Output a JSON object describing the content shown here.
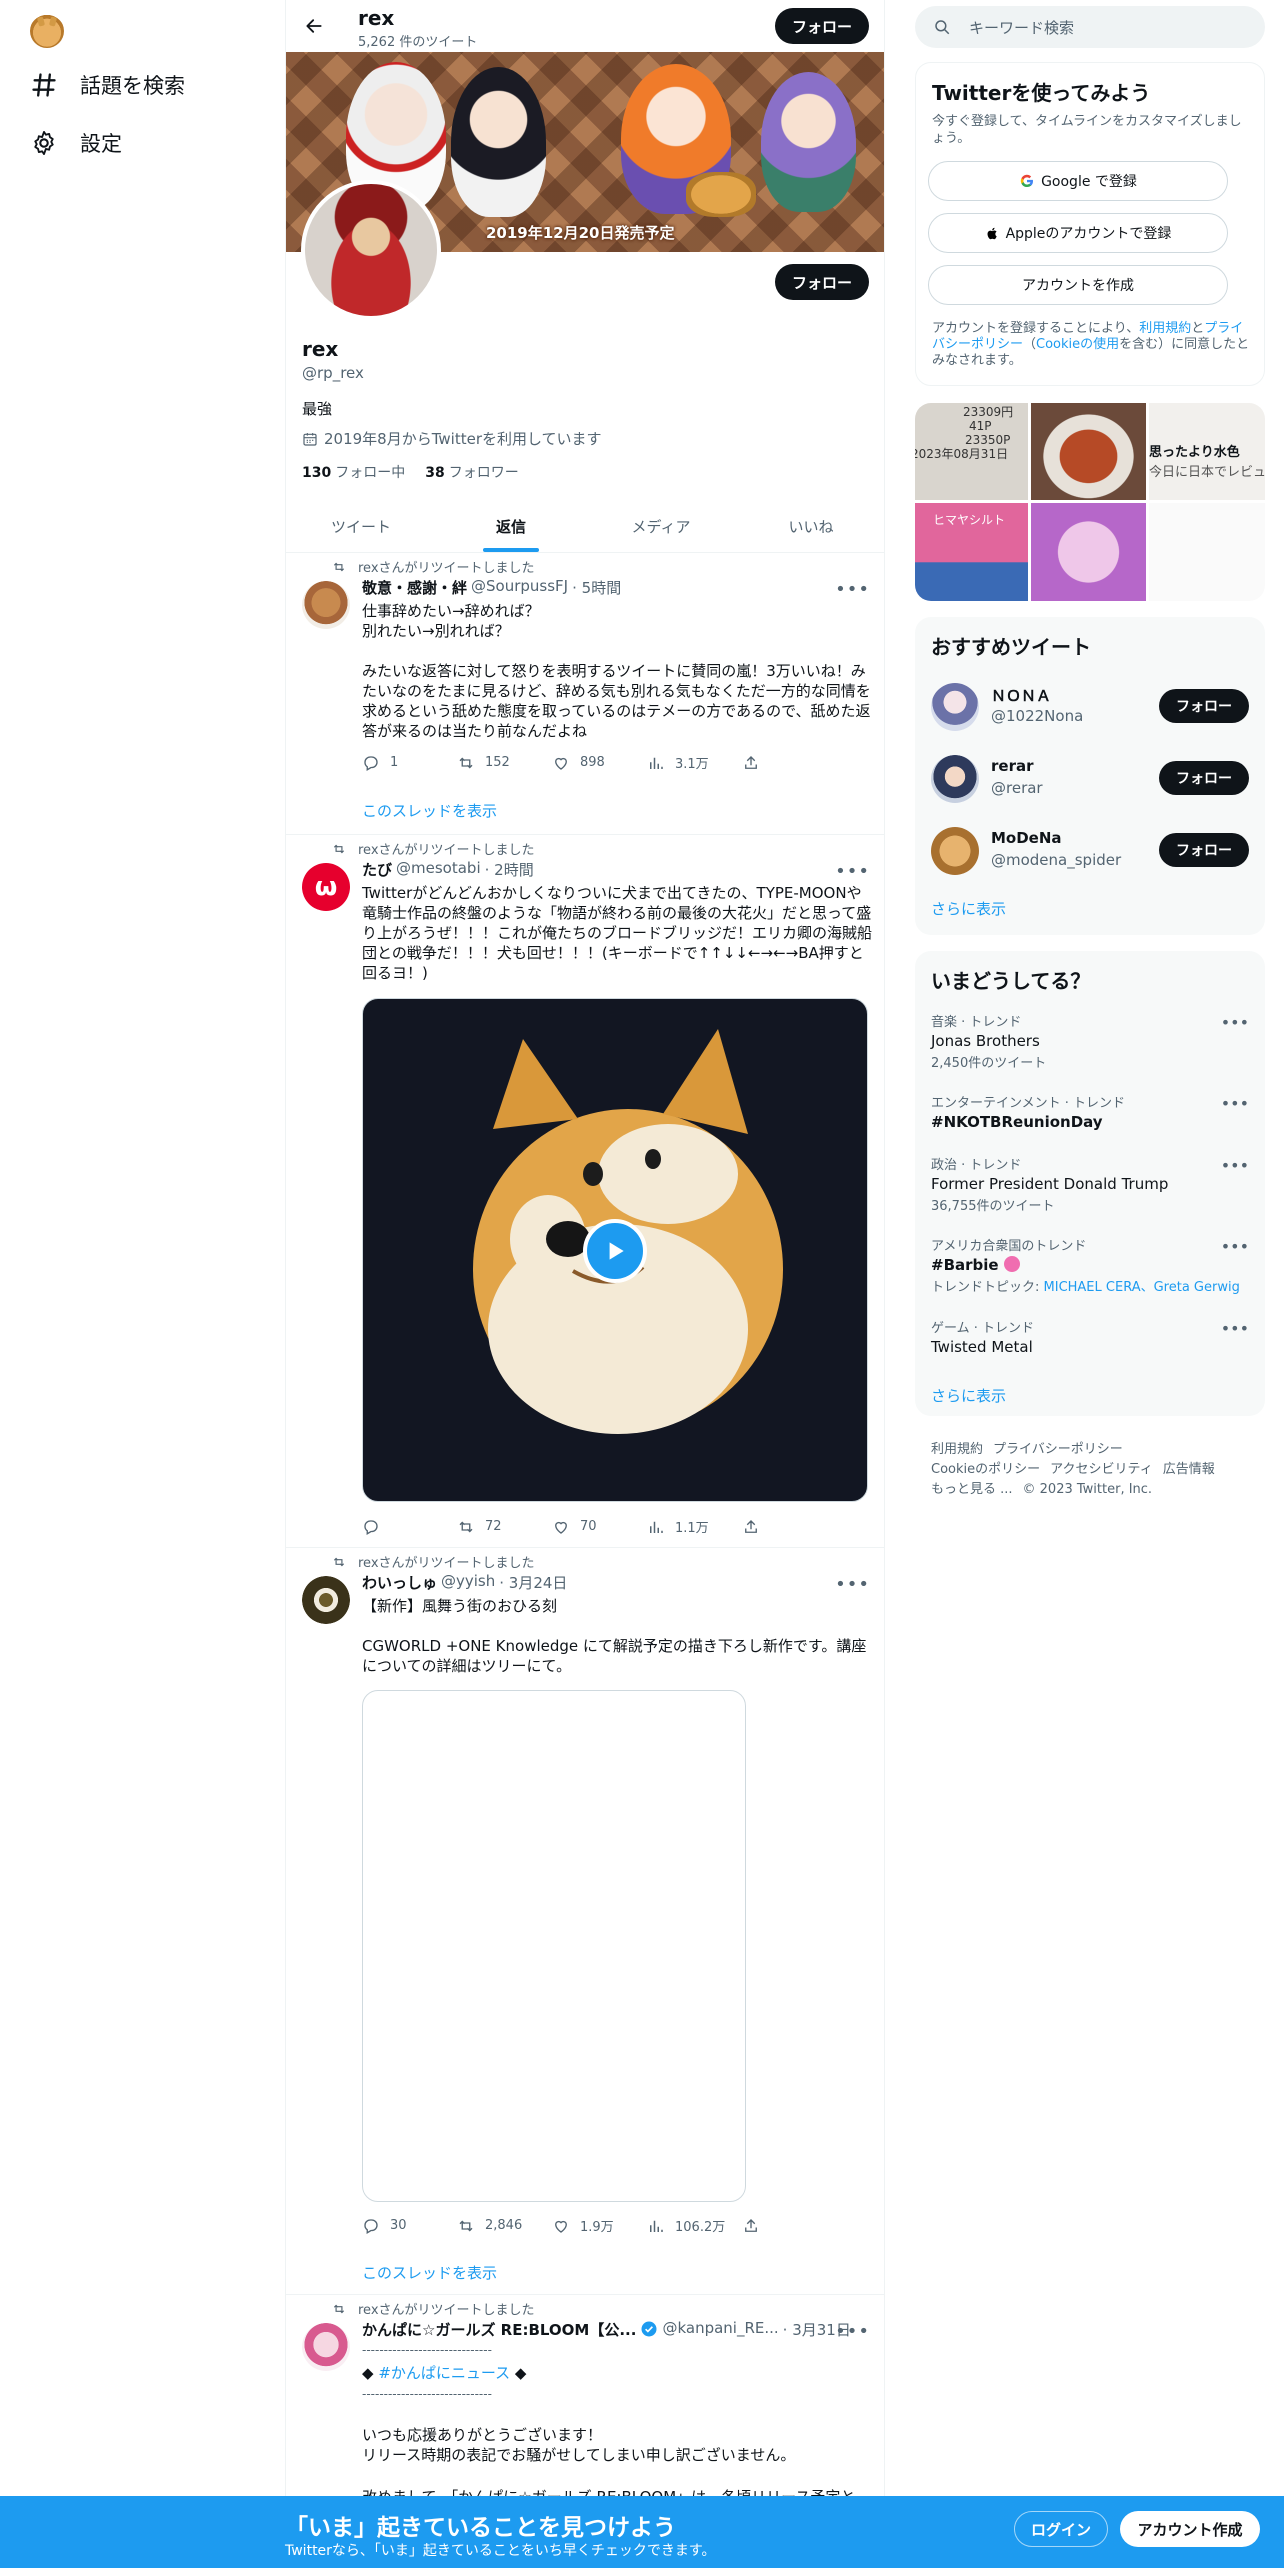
{
  "nav": {
    "explore_label": "話題を検索",
    "settings_label": "設定"
  },
  "profile_header": {
    "name": "rex",
    "tweet_count": "5,262 件のツイート",
    "follow_label": "フォロー"
  },
  "banner": {
    "release_text": "2019年12月20日発売予定"
  },
  "profile": {
    "name": "rex",
    "handle": "@rp_rex",
    "bio": "最強",
    "joined": "2019年8月からTwitterを利用しています",
    "following_count": "130",
    "following_label": "フォロー中",
    "followers_count": "38",
    "followers_label": "フォロワー",
    "follow_label": "フォロー"
  },
  "tabs": [
    "ツイート",
    "返信",
    "メディア",
    "いいね"
  ],
  "tweets": [
    {
      "retweet_label": "rexさんがリツイートしました",
      "name": "敬意・感謝・絆",
      "handle": "@SourpussFJ",
      "time": "· 5時間",
      "text": "仕事辞めたい→辞めれば？\n別れたい→別れれば？\n\nみたいな返答に対して怒りを表明するツイートに賛同の嵐！3万いいね！みたいなのをたまに見るけど、辞める気も別れる気もなくただ一方的な同情を求めるという舐めた態度を取っているのはテメーの方であるので、舐めた返答が来るのは当たり前なんだよね",
      "replies": "1",
      "retweets": "152",
      "likes": "898",
      "views": "3.1万",
      "thread_label": "このスレッドを表示"
    },
    {
      "retweet_label": "rexさんがリツイートしました",
      "name": "たび",
      "handle": "@mesotabi",
      "time": "· 2時間",
      "text": "Twitterがどんどんおかしくなりついに犬まで出てきたの、TYPE-MOONや竜騎士作品の終盤のような「物語が終わる前の最後の大花火」だと思って盛り上がろうぜ！！！これが俺たちのブロードブリッジだ！エリカ卿の海賊船団との戦争だ！！！犬も回せ！！！(キーボードで↑↑↓↓←→←→BA押すと回るヨ！)",
      "replies": "",
      "retweets": "72",
      "likes": "70",
      "views": "1.1万"
    },
    {
      "retweet_label": "rexさんがリツイートしました",
      "name": "わいっしゅ",
      "handle": "@yyish",
      "time": "· 3月24日",
      "text": "【新作】風舞う街のおひる刻\n\nCGWORLD +ONE Knowledge にて解説予定の描き下ろし新作です。講座についての詳細はツリーにて。",
      "replies": "30",
      "retweets": "2,846",
      "likes": "1.9万",
      "views": "106.2万",
      "thread_label": "このスレッドを表示"
    },
    {
      "retweet_label": "rexさんがリツイートしました",
      "name": "かんぱに☆ガールズ RE:BLOOM【公...",
      "handle": "@kanpani_RE...",
      "time": "· 3月31日",
      "line_1": "‐‐‐‐‐‐‐‐‐‐‐‐‐‐‐‐‐‐‐‐‐‐‐‐‐‐‐‐‐‐",
      "hashtag_line_prefix": "◆ ",
      "hashtag": "#かんぱにニュース",
      "hashtag_line_suffix": " ◆",
      "line_2": "‐‐‐‐‐‐‐‐‐‐‐‐‐‐‐‐‐‐‐‐‐‐‐‐‐‐‐‐‐‐",
      "text": "いつも応援ありがとうございます！\nリリース時期の表記でお騒がせしてしまい申し訳ございません。",
      "text_cut": "改めまして、「かんぱに☆ガールズ RE:BLOOM」は、冬頃リリース予定と"
    }
  ],
  "right": {
    "search_placeholder": "キーワード検索",
    "signup_title": "Twitterを使ってみよう",
    "signup_sub": "今すぐ登録して、タイムラインをカスタマイズしましょう。",
    "google_label": "Google で登録",
    "apple_label": "Appleのアカウントで登録",
    "create_label": "アカウントを作成",
    "legal_pre": "アカウントを登録することにより、",
    "legal_terms": "利用規約",
    "legal_and": "と",
    "legal_privacy": "プライバシーポリシー",
    "legal_paren_open": "（",
    "legal_cookie": "Cookieの使用",
    "legal_post": "を含む）に同意したとみなされます。",
    "photos": {
      "p1_a": "23309円",
      "p1_b": "41P",
      "p1_c": "23350P",
      "p1_d": "2023年08月31日",
      "p3_a": "思ったより水色",
      "p3_b": "今日に日本でレビュー",
      "p4": "ヒマヤシルト"
    },
    "recommended_title": "おすすめツイート",
    "suggestions": [
      {
        "name": "ＮＯＮＡ",
        "handle": "@1022Nona",
        "follow": "フォロー"
      },
      {
        "name": "rerar",
        "handle": "@rerar",
        "follow": "フォロー"
      },
      {
        "name": "MoDeNa",
        "handle": "@modena_spider",
        "follow": "フォロー"
      }
    ],
    "show_more": "さらに表示",
    "trends_title": "いまどうしてる？",
    "trends": [
      {
        "cat": "音楽 · トレンド",
        "title": "Jonas Brothers",
        "count": "2,450件のツイート"
      },
      {
        "cat": "エンターテインメント · トレンド",
        "title": "#NKOTBReunionDay",
        "count": ""
      },
      {
        "cat": "政治 · トレンド",
        "title": "Former President Donald Trump",
        "count": "36,755件のツイート"
      },
      {
        "cat": "アメリカ合衆国のトレンド",
        "title": "#Barbie",
        "count_prefix": "トレンドトピック: ",
        "count_links": "MICHAEL CERA、Greta Gerwig"
      },
      {
        "cat": "ゲーム · トレンド",
        "title": "Twisted Metal",
        "count": ""
      }
    ],
    "trends_more": "さらに表示",
    "footer": {
      "terms": "利用規約",
      "privacy": "プライバシーポリシー",
      "cookie": "Cookieのポリシー",
      "accessibility": "アクセシビリティ",
      "ads": "広告情報",
      "more": "もっと見る ...",
      "copyright": "© 2023 Twitter, Inc."
    }
  },
  "bottom": {
    "title": "「いま」起きていることを見つけよう",
    "sub": "Twitterなら、「いま」起きていることをいち早くチェックできます。",
    "login": "ログイン",
    "signup": "アカウント作成"
  },
  "colors": {
    "accent": "#1d9bf0",
    "text": "#0f1419",
    "secondary": "#536471"
  }
}
